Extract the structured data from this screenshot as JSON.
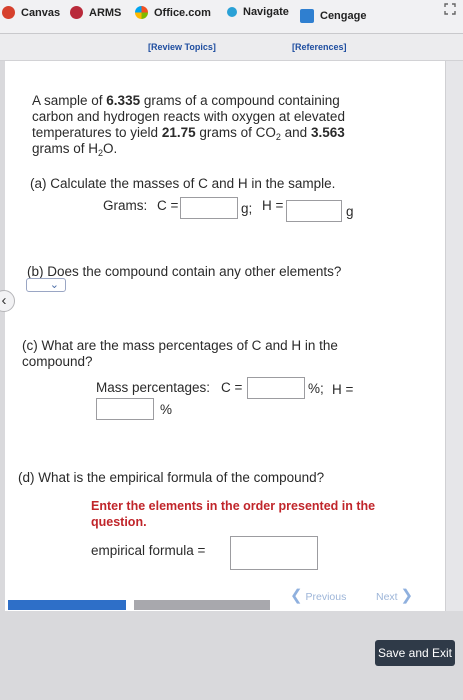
{
  "bookmarks": [
    {
      "label": "Canvas",
      "icon": "canvas-icon"
    },
    {
      "label": "ARMS",
      "icon": "arms-icon"
    },
    {
      "label": "Office.com",
      "icon": "office-icon"
    },
    {
      "label": "Navigate",
      "icon": "navigate-icon"
    },
    {
      "label": "Cengage",
      "icon": "cengage-icon"
    }
  ],
  "links": {
    "review": "[Review Topics]",
    "references": "[References]"
  },
  "problem": {
    "intro1": "A sample of ",
    "mass": "6.335",
    "intro2": " grams of a compound containing",
    "line2": "carbon and hydrogen reacts with oxygen at elevated",
    "line3a": "temperatures to yield ",
    "co2_mass": "21.75",
    "line3b": " grams of CO",
    "co2_sub": "2",
    "line3c": " and ",
    "h2o_mass": "3.563",
    "line4a": "grams of H",
    "h2o_sub": "2",
    "line4b": "O."
  },
  "part_a": {
    "question": "(a) Calculate the masses of C and H in the sample.",
    "grams_label": "Grams:",
    "c_label": "C =",
    "c_unit": "g;",
    "h_label": "H =",
    "h_unit": "g",
    "c_value": "",
    "h_value": ""
  },
  "part_b": {
    "question": "(b) Does the compound contain any other elements?",
    "selected": ""
  },
  "part_c": {
    "question1": "(c) What are the mass percentages of C and H in the",
    "question2": "compound?",
    "label": "Mass percentages:",
    "c_label": "C =",
    "c_unit": "%;",
    "h_label": "H =",
    "h_unit": "%",
    "c_value": "",
    "h_value": ""
  },
  "part_d": {
    "question": "(d) What is the empirical formula of the compound?",
    "instruction1": "Enter the elements in the order presented in the",
    "instruction2": "question.",
    "label": "empirical formula =",
    "value": ""
  },
  "navigation": {
    "previous": "Previous",
    "next": "Next",
    "save_exit": "Save and Exit"
  },
  "progress": {
    "segments": 2,
    "current": 1
  },
  "colors": {
    "accent": "#2e6fc8",
    "required_text": "#c0252a",
    "link": "#1f4ea0",
    "save_button": "#2f3a48"
  }
}
